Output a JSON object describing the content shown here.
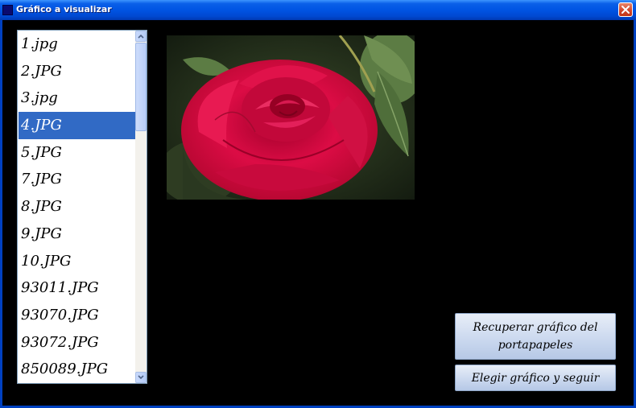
{
  "window": {
    "title": "Gráfico a visualizar"
  },
  "files": {
    "items": [
      "1.jpg",
      "2.JPG",
      "3.jpg",
      "4.JPG",
      "5.JPG",
      "7.JPG",
      "8.JPG",
      "9.JPG",
      "10.JPG",
      "93011.JPG",
      "93070.JPG",
      "93072.JPG",
      "850089.JPG"
    ],
    "selected": "4.JPG"
  },
  "buttons": {
    "recover_label": "Recuperar gráfico del portapapeles",
    "choose_label": "Elegir gráfico y seguir"
  },
  "colors": {
    "titlebar": "#0054e3",
    "selection": "#316ac5",
    "background": "#000000"
  }
}
